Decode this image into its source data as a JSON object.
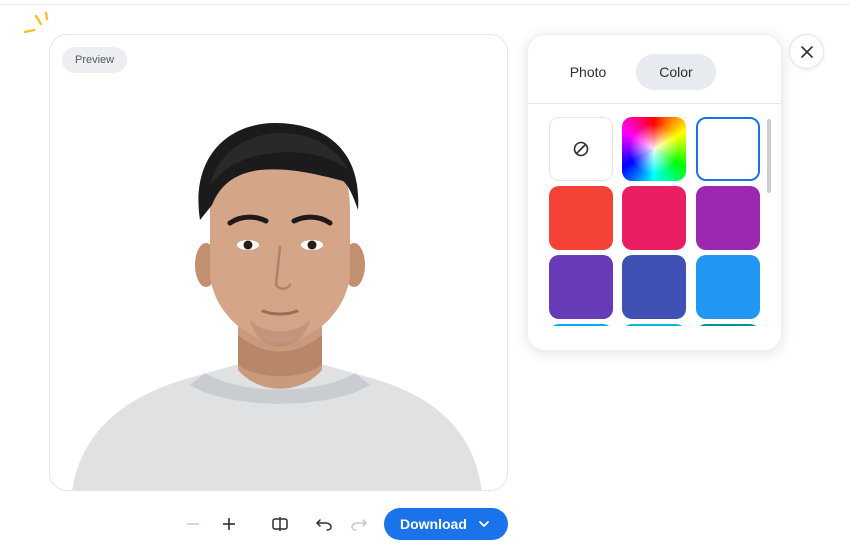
{
  "preview": {
    "badge": "Preview",
    "image_alt": "Portrait of a man in a white t-shirt on a white background"
  },
  "background_panel": {
    "tabs": [
      {
        "label": "Photo",
        "active": false
      },
      {
        "label": "Color",
        "active": true
      }
    ],
    "swatches": [
      {
        "name": "none",
        "color": "#ffffff",
        "icon": "no-color-icon"
      },
      {
        "name": "custom-gradient",
        "color": "conic-gradient"
      },
      {
        "name": "white",
        "color": "#ffffff",
        "selected": true
      },
      {
        "name": "red-orange",
        "color": "#f44336"
      },
      {
        "name": "pink",
        "color": "#e91e63"
      },
      {
        "name": "purple",
        "color": "#9c27b0"
      },
      {
        "name": "deep-purple",
        "color": "#673ab7"
      },
      {
        "name": "indigo",
        "color": "#3f51b5"
      },
      {
        "name": "blue",
        "color": "#2196f3"
      },
      {
        "name": "light-blue",
        "color": "#03a9f4"
      },
      {
        "name": "cyan",
        "color": "#00bcd4"
      },
      {
        "name": "teal",
        "color": "#009688"
      }
    ]
  },
  "toolbar": {
    "zoom_out_icon": "minus-icon",
    "zoom_in_icon": "plus-icon",
    "compare_icon": "compare-icon",
    "undo_icon": "undo-icon",
    "redo_icon": "redo-icon",
    "download_label": "Download"
  },
  "accent_color": "#1a73e8"
}
